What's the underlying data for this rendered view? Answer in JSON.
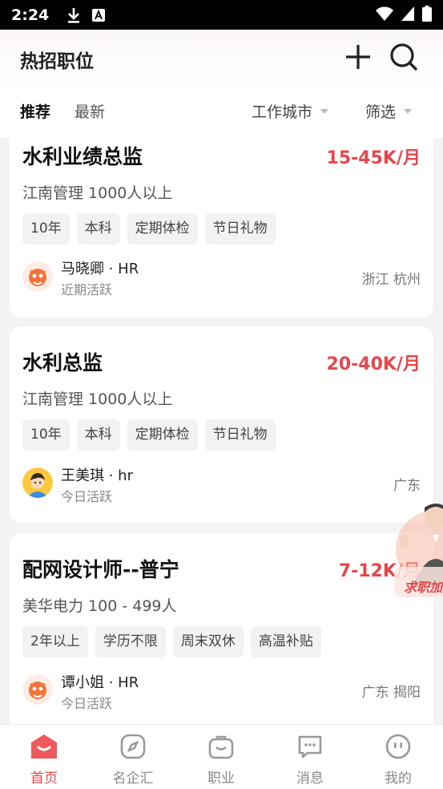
{
  "status_bar": {
    "time": "2:24"
  },
  "header": {
    "title": "热招职位"
  },
  "tabs": [
    {
      "label": "推荐"
    },
    {
      "label": "最新"
    }
  ],
  "filters": {
    "city": "工作城市",
    "filter": "筛选"
  },
  "jobs": [
    {
      "title": "水利业绩总监",
      "salary": "15-45K/月",
      "company": "江南管理 1000人以上",
      "tags": [
        "10年",
        "本科",
        "定期体检",
        "节日礼物"
      ],
      "hr_name": "马晓卿 · HR",
      "hr_active": "近期活跃",
      "location": "浙江 杭州"
    },
    {
      "title": "水利总监",
      "salary": "20-40K/月",
      "company": "江南管理 1000人以上",
      "tags": [
        "10年",
        "本科",
        "定期体检",
        "节日礼物"
      ],
      "hr_name": "王美琪 · hr",
      "hr_active": "今日活跃",
      "location": "广东"
    },
    {
      "title": "配网设计师--普宁",
      "salary": "7-12K/月",
      "company": "美华电力 100 - 499人",
      "tags": [
        "2年以上",
        "学历不限",
        "周末双休",
        "高温补贴"
      ],
      "hr_name": "谭小姐 · HR",
      "hr_active": "今日活跃",
      "location": "广东 揭阳"
    }
  ],
  "promo": {
    "label": "求职加速"
  },
  "bottom_nav": [
    {
      "label": "首页",
      "icon": "home-icon"
    },
    {
      "label": "名企汇",
      "icon": "compass-icon"
    },
    {
      "label": "职业",
      "icon": "bag-icon"
    },
    {
      "label": "消息",
      "icon": "message-icon"
    },
    {
      "label": "我的",
      "icon": "profile-icon"
    }
  ],
  "colors": {
    "accent": "#e8464a",
    "background": "#f3f3f5"
  }
}
